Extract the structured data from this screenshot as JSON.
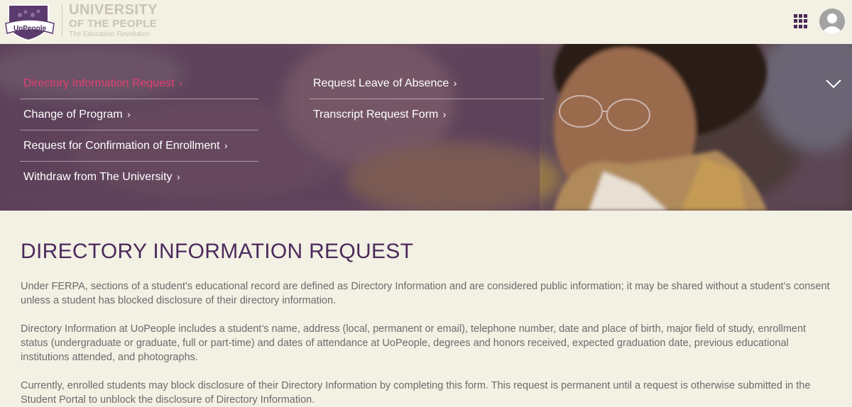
{
  "brand": {
    "shield_text": "UoPeople",
    "name_line1": "UNIVERSITY",
    "name_line2": "OF THE PEOPLE",
    "tagline": "The Education Revolution"
  },
  "header": {
    "apps_icon": "grid-apps-icon",
    "avatar_icon": "user-avatar-icon"
  },
  "nav": {
    "column1": [
      {
        "label": "Directory Information Request",
        "active": true
      },
      {
        "label": "Change of Program",
        "active": false
      },
      {
        "label": "Request for Confirmation of Enrollment",
        "active": false
      },
      {
        "label": "Withdraw from The University",
        "active": false
      }
    ],
    "column2": [
      {
        "label": "Request Leave of Absence",
        "active": false
      },
      {
        "label": "Transcript Request Form",
        "active": false
      }
    ],
    "chevron_glyph": "›",
    "active_color": "#e2406d"
  },
  "main": {
    "title": "DIRECTORY INFORMATION REQUEST",
    "paragraphs": [
      "Under FERPA, sections of a student’s educational record are defined as Directory Information and are considered public information; it may be shared without a student’s consent unless a student has blocked disclosure of their directory information.",
      "Directory Information at UoPeople includes a student’s name, address (local, permanent or email), telephone number, date and place of birth, major field of study, enrollment status (undergraduate or graduate, full or part-time) and dates of attendance at UoPeople, degrees and honors received, expected graduation date, previous educational institutions attended, and photographs.",
      "Currently, enrolled students may block disclosure of their Directory Information by completing this form. This request is permanent until a request is otherwise submitted in the Student Portal to unblock the disclosure of Directory Information."
    ]
  },
  "colors": {
    "brand_purple": "#4b2a5c",
    "background": "#f3f0e4",
    "body_text": "#6b6b6b"
  }
}
